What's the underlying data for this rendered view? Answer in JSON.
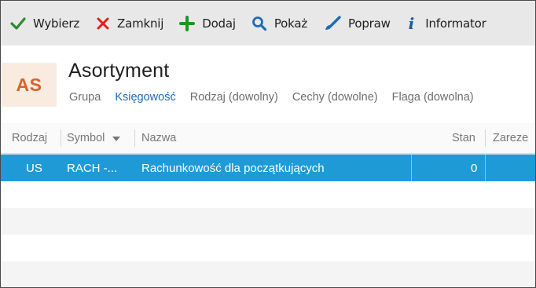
{
  "toolbar": {
    "buttons": [
      {
        "label": "Wybierz",
        "icon": "checkmark-icon",
        "color": "#2e8b2e"
      },
      {
        "label": "Zamknij",
        "icon": "close-icon",
        "color": "#e02020"
      },
      {
        "label": "Dodaj",
        "icon": "plus-icon",
        "color": "#1a9a1a"
      },
      {
        "label": "Pokaż",
        "icon": "search-icon",
        "color": "#1e6bb8"
      },
      {
        "label": "Popraw",
        "icon": "brush-icon",
        "color": "#1e6bb8"
      },
      {
        "label": "Informator",
        "icon": "info-icon",
        "color": "#1e5a9a"
      }
    ]
  },
  "header": {
    "badge": "AS",
    "title": "Asortyment",
    "filters": {
      "group_label": "Grupa",
      "group_value": "Księgowość",
      "kind": "Rodzaj (dowolny)",
      "features": "Cechy (dowolne)",
      "flag": "Flaga (dowolna)"
    }
  },
  "grid": {
    "columns": [
      "Rodzaj",
      "Symbol",
      "Nazwa",
      "Stan",
      "Zareze"
    ],
    "rows": [
      {
        "rodzaj": "US",
        "symbol": "RACH -...",
        "nazwa": "Rachunkowość dla początkujących",
        "stan": "0",
        "zarez": ""
      }
    ]
  },
  "colors": {
    "selection": "#1e9bd7",
    "badge_bg": "#f9ebdf",
    "badge_fg": "#d9632b",
    "link": "#1e6bb8"
  }
}
